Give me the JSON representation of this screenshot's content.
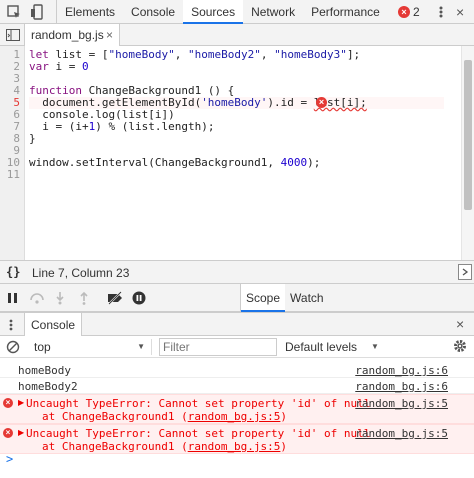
{
  "toolbar": {
    "tabs": [
      "Elements",
      "Console",
      "Sources",
      "Network",
      "Performance"
    ],
    "active_tab": "Sources",
    "error_count": "2",
    "error_glyph": "×",
    "close_glyph": "×"
  },
  "editor": {
    "file_tab": "random_bg.js",
    "file_close": "×",
    "lines": [
      {
        "n": "1",
        "code": "let list = [\"homeBody\", \"homeBody2\", \"homeBody3\"];"
      },
      {
        "n": "2",
        "code": "var i = 0"
      },
      {
        "n": "3",
        "code": ""
      },
      {
        "n": "4",
        "code": "function ChangeBackground1 () {"
      },
      {
        "n": "5",
        "code": "  document.getElementById('homeBody').id = list[i];"
      },
      {
        "n": "6",
        "code": "  console.log(list[i])"
      },
      {
        "n": "7",
        "code": "  i = (i+1) % (list.length);"
      },
      {
        "n": "8",
        "code": "}"
      },
      {
        "n": "9",
        "code": ""
      },
      {
        "n": "10",
        "code": "window.setInterval(ChangeBackground1, 4000);"
      },
      {
        "n": "11",
        "code": ""
      }
    ],
    "error_line": "5"
  },
  "status": {
    "braces": "{}",
    "position": "Line 7, Column 23"
  },
  "debugger": {
    "scope_tab": "Scope",
    "watch_tab": "Watch"
  },
  "drawer": {
    "console_tab": "Console",
    "close_glyph": "×"
  },
  "console_toolbar": {
    "context": "top",
    "filter_placeholder": "Filter",
    "levels": "Default levels"
  },
  "messages": [
    {
      "type": "log",
      "text": "homeBody",
      "source": "random_bg.js:6"
    },
    {
      "type": "log",
      "text": "homeBody2",
      "source": "random_bg.js:6"
    },
    {
      "type": "error",
      "text": "Uncaught TypeError: Cannot set property 'id' of null",
      "stack": "at ChangeBackground1 (",
      "stack_link": "random_bg.js:5",
      "stack_end": ")",
      "source": "random_bg.js:5"
    },
    {
      "type": "error",
      "text": "Uncaught TypeError: Cannot set property 'id' of null",
      "stack": "at ChangeBackground1 (",
      "stack_link": "random_bg.js:5",
      "stack_end": ")",
      "source": "random_bg.js:5"
    }
  ],
  "prompt_glyph": ">"
}
